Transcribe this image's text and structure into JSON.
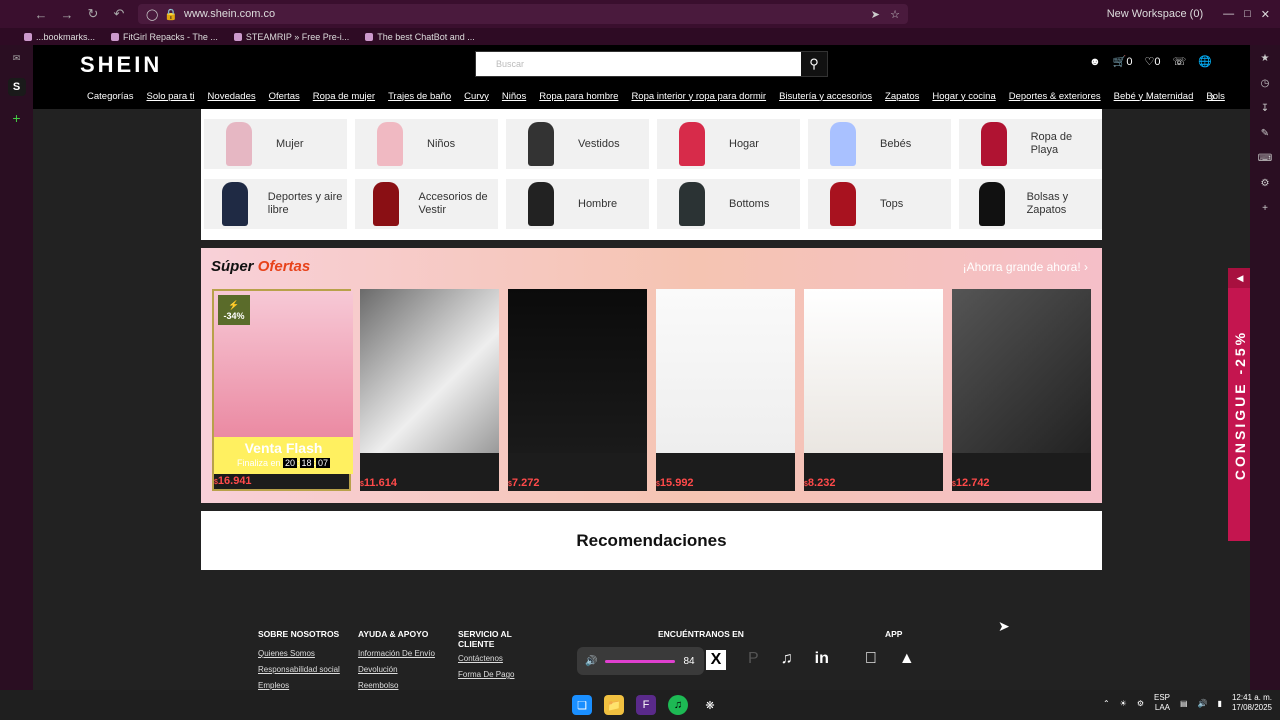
{
  "browser": {
    "url": "www.shein.com.co",
    "workspace": "New Workspace (0)",
    "bookmarks": [
      "...bookmarks...",
      "FitGirl Repacks - The ...",
      "STEAMRIP » Free Pre-i...",
      "The best ChatBot and ..."
    ]
  },
  "shein": {
    "logo": "SHEIN",
    "search_placeholder": "Buscar",
    "cart_count": "0",
    "wishlist_count": "0",
    "nav": [
      "Categorías",
      "Solo para ti",
      "Novedades",
      "Ofertas",
      "Ropa de mujer",
      "Trajes de baño",
      "Curvy",
      "Niños",
      "Ropa para hombre",
      "Ropa interior y ropa para dormir",
      "Bisutería y accesorios",
      "Zapatos",
      "Hogar y cocina",
      "Deportes & exteriores",
      "Bebé y Maternidad",
      "Bols"
    ],
    "categories": [
      {
        "label": "Mujer"
      },
      {
        "label": "Niños"
      },
      {
        "label": "Vestidos"
      },
      {
        "label": "Hogar"
      },
      {
        "label": "Bebés"
      },
      {
        "label": "Ropa de Playa"
      },
      {
        "label": "Deportes y aire libre"
      },
      {
        "label": "Accesorios de Vestir"
      },
      {
        "label": "Hombre"
      },
      {
        "label": "Bottoms"
      },
      {
        "label": "Tops"
      },
      {
        "label": "Bolsas y Zapatos"
      }
    ],
    "super_ofertas": {
      "title_a": "Súper ",
      "title_b": "Ofertas",
      "ahorra": "¡Ahorra grande ahora!",
      "flash": {
        "title": "Venta Flash",
        "ends": "Finaliza en",
        "h": "20",
        "m": "18",
        "s": "07",
        "discount": "-34%"
      },
      "prices": [
        "16.941",
        "11.614",
        "7.272",
        "15.992",
        "8.232",
        "12.742"
      ],
      "currency": "$"
    },
    "recomendaciones": "Recomendaciones",
    "consigue": "CONSIGUE -25%",
    "footer": {
      "sobre": {
        "h": "SOBRE NOSOTROS",
        "links": [
          "Quienes Somos",
          "Responsabilidad social",
          "Empleos"
        ]
      },
      "ayuda": {
        "h": "AYUDA & APOYO",
        "links": [
          "Información De Envío",
          "Devolución",
          "Reembolso"
        ]
      },
      "servicio": {
        "h": "SERVICIO AL CLIENTE",
        "links": [
          "Contáctenos",
          "Forma De Pago"
        ]
      },
      "encuentranos": "ENCUÉNTRANOS EN",
      "app": "APP"
    }
  },
  "volume": "84",
  "tray": {
    "lang1": "ESP",
    "lang2": "LAA",
    "time": "12:41 a. m.",
    "date": "17/08/2025"
  }
}
